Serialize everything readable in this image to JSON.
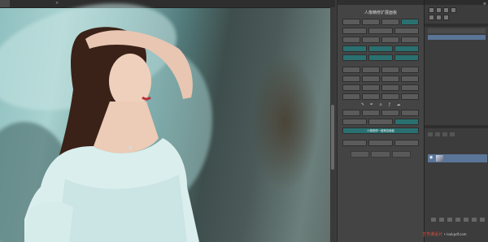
{
  "document": {
    "tab_label": "",
    "close_glyph": "×"
  },
  "plugin_panel": {
    "header": "",
    "title": "人像精修扩展面板",
    "rows": [
      [
        "",
        "",
        "",
        ""
      ],
      [
        "",
        "",
        ""
      ],
      [
        "",
        "",
        "",
        ""
      ],
      [
        "",
        "",
        ""
      ],
      [
        "",
        "",
        ""
      ],
      [
        "",
        "",
        "",
        ""
      ],
      [
        "",
        "",
        "",
        ""
      ],
      [
        "",
        "",
        "",
        ""
      ],
      [
        "",
        "",
        "",
        ""
      ]
    ],
    "bottom_wide_button": "人像精修一键美容面板",
    "bottom_row": [
      "",
      "",
      ""
    ]
  },
  "right_panel": {
    "history_label": "",
    "history_items": [
      "",
      ""
    ],
    "layers_tabs": [
      "",
      "",
      ""
    ],
    "layer_name": ""
  },
  "watermark": {
    "brand": "五节课设计",
    "site": "• lookpdf.com"
  },
  "colors": {
    "panel_bg": "#444444",
    "teal_button": "#2a7070",
    "selection": "#5a7597",
    "brand_red": "#e74c3c"
  }
}
